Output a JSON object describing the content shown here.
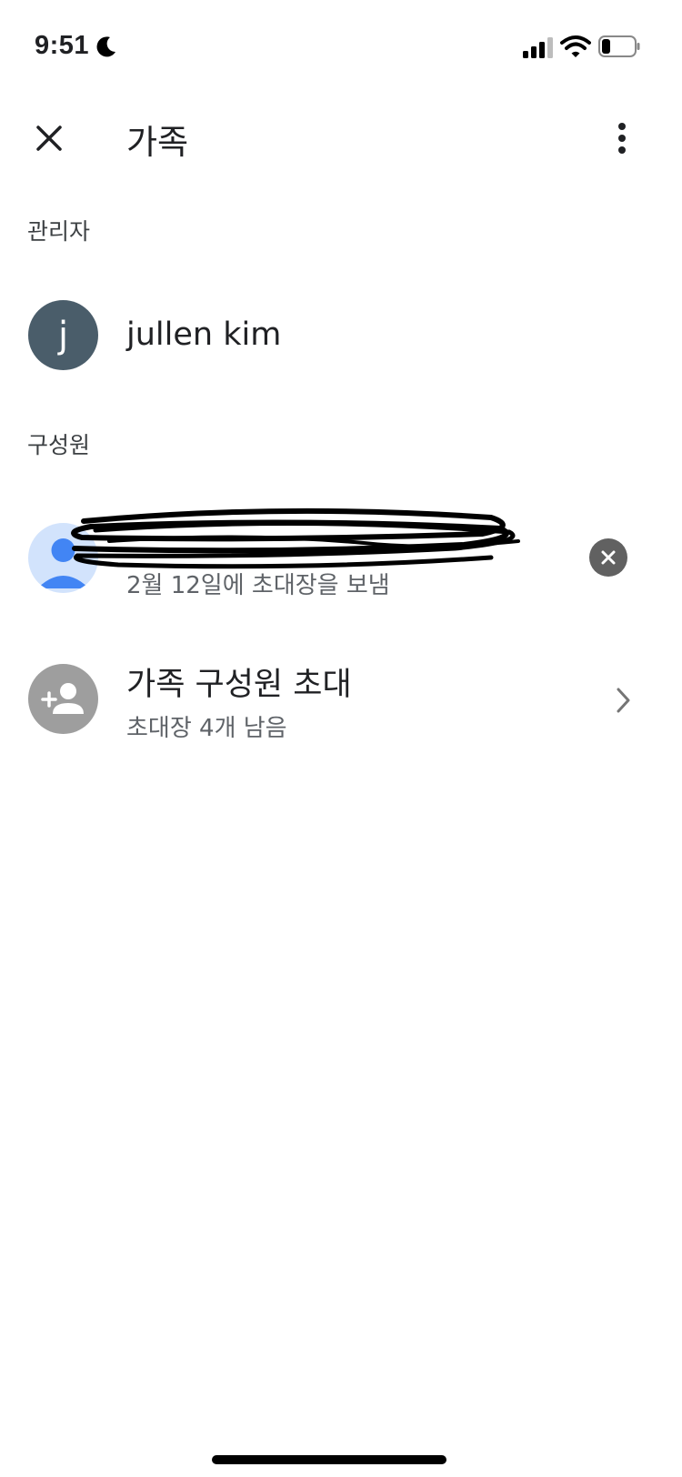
{
  "status_bar": {
    "time": "9:51",
    "icons": [
      "moon-icon",
      "signal-icon",
      "wifi-icon",
      "battery-icon"
    ]
  },
  "app_bar": {
    "title": "가족",
    "close_icon": "close-icon",
    "more_icon": "more-vert-icon"
  },
  "admin_section": {
    "label": "관리자",
    "member": {
      "avatar_letter": "j",
      "name": "jullen kim"
    }
  },
  "members_section": {
    "label": "구성원",
    "pending_member": {
      "subtitle": "2월 12일에 초대장을 보냄",
      "avatar_icon": "person-icon",
      "remove_icon": "cancel-icon"
    },
    "invite": {
      "title": "가족 구성원 초대",
      "subtitle": "초대장 4개 남음",
      "icon": "person-add-icon",
      "chevron_icon": "chevron-right-icon"
    }
  },
  "colors": {
    "admin_avatar": "#4a5d6a",
    "member_avatar_bg": "#d2e3fc",
    "member_avatar_fg": "#4285f4",
    "invite_avatar": "#9e9e9e",
    "secondary_text": "#5f6368"
  }
}
